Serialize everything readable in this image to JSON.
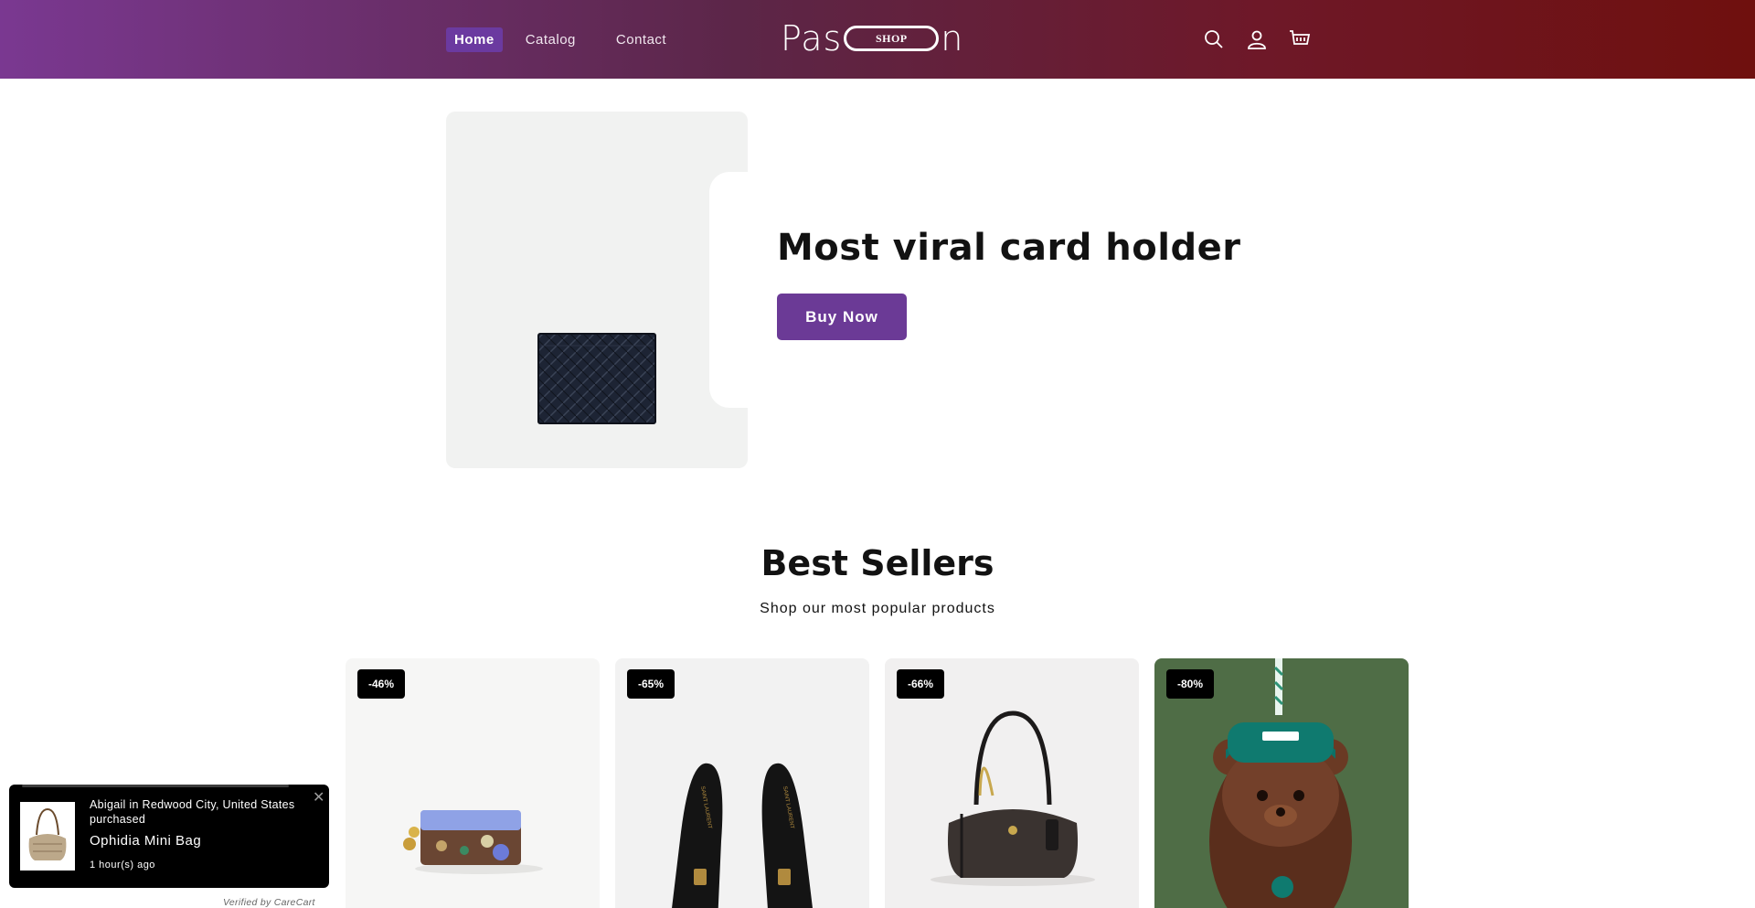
{
  "header": {
    "nav": [
      {
        "label": "Home",
        "active": true
      },
      {
        "label": "Catalog",
        "active": false
      },
      {
        "label": "Contact",
        "active": false
      }
    ],
    "logo": {
      "left": "Pas",
      "pill": "SHOP",
      "right": "n"
    },
    "icons": [
      "search-icon",
      "account-icon",
      "cart-icon"
    ]
  },
  "hero": {
    "title": "Most viral card holder",
    "button": "Buy Now"
  },
  "best_sellers": {
    "title": "Best Sellers",
    "subtitle": "Shop our most popular products",
    "products": [
      {
        "badge": "-46%"
      },
      {
        "badge": "-65%"
      },
      {
        "badge": "-66%"
      },
      {
        "badge": "-80%"
      }
    ]
  },
  "popup": {
    "buyer": "Abigail in Redwood City, United States purchased",
    "product": "Ophidia Mini Bag",
    "time": "1 hour(s) ago",
    "close": "✕",
    "verified": "Verified by CareCart"
  },
  "colors": {
    "accent": "#6b3a96",
    "header_start": "#7a3891",
    "header_end": "#6f100e"
  }
}
